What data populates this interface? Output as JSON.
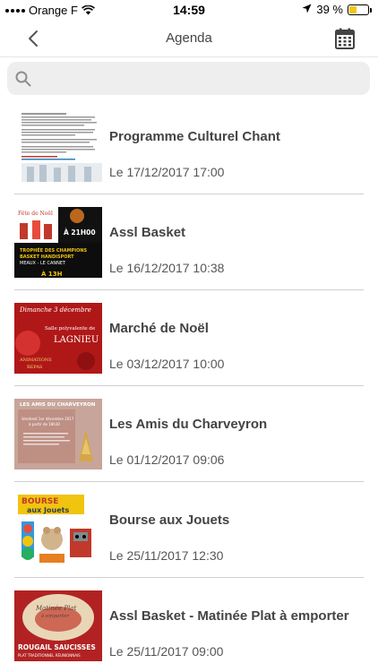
{
  "status_bar": {
    "carrier": "Orange F",
    "time": "14:59",
    "battery": "39 %",
    "battery_level": 0.39
  },
  "nav": {
    "title": "Agenda",
    "back_icon": "chevron-left-icon",
    "calendar_icon": "calendar-icon"
  },
  "search": {
    "placeholder": "",
    "value": "",
    "icon": "search-icon"
  },
  "events": [
    {
      "title": "Programme Culturel Chant",
      "date": "Le 17/12/2017 17:00"
    },
    {
      "title": "Assl Basket",
      "date": "Le 16/12/2017 10:38"
    },
    {
      "title": "Marché de Noël",
      "date": "Le 03/12/2017 10:00"
    },
    {
      "title": "Les Amis du Charveyron",
      "date": "Le 01/12/2017 09:06"
    },
    {
      "title": "Bourse aux Jouets",
      "date": "Le 25/11/2017 12:30"
    },
    {
      "title": "Assl Basket - Matinée Plat à emporter",
      "date": "Le 25/11/2017 09:00"
    }
  ],
  "thumb_text": {
    "basket_poster": [
      "Fête de Noël",
      "À 21H00",
      "TROPHÉE DES CHAMPIONS",
      "BASKET HANDISPORT",
      "MEAUX - LE CANNET",
      "À 13H"
    ],
    "noel_poster": [
      "Dimanche 3 décembre",
      "Salle polyvalente de",
      "LAGNIEU",
      "ANIMATIONS",
      "REPAS"
    ],
    "charveyron_poster": [
      "LES AMIS DU CHARVEYRON",
      "Vendredi 1er décembre 2017",
      "à partir de 18h30"
    ],
    "jouets_poster": [
      "BOURSE",
      "aux Jouets"
    ],
    "matinee_poster": [
      "Matinée Plat",
      "à emporter",
      "ROUGAIL SAUCISSES",
      "PLAT TRADITIONNEL RÉUNIONNAIS"
    ]
  }
}
